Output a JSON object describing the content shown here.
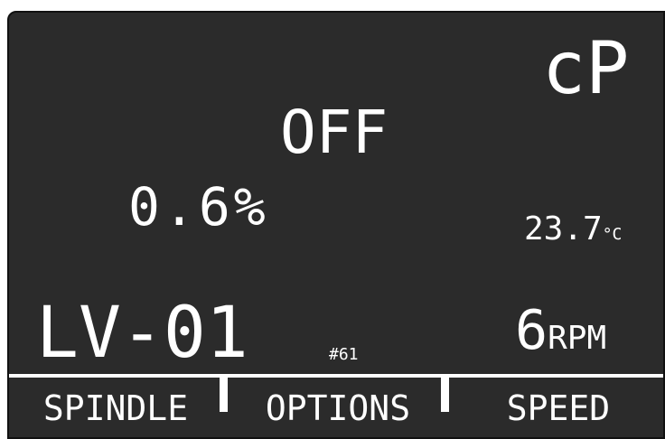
{
  "display": {
    "units_label": "cP",
    "motor_state": "OFF",
    "torque": {
      "value": "0.6",
      "unit": "%"
    },
    "temperature": {
      "value": "23.7",
      "unit": "°C"
    },
    "spindle": {
      "model": "LV-01",
      "number": "#61"
    },
    "speed": {
      "value": "6",
      "unit": "RPM"
    }
  },
  "softkeys": {
    "spindle": "SPINDLE",
    "options": "OPTIONS",
    "speed": "SPEED"
  },
  "colors": {
    "screen_bg": "#2b2b2b",
    "text": "#ffffff"
  }
}
